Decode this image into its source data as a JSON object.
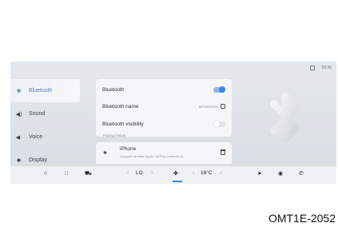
{
  "status": {
    "time": "09:36"
  },
  "sidebar": {
    "items": [
      {
        "label": "Bluetooth",
        "icon": "bluetooth-icon",
        "glyph": "✱",
        "active": true
      },
      {
        "label": "Sound",
        "icon": "speaker-icon",
        "glyph": "◀)",
        "active": false
      },
      {
        "label": "Voice",
        "icon": "voice-icon",
        "glyph": "◀·",
        "active": false
      },
      {
        "label": "Display",
        "icon": "brightness-icon",
        "glyph": "✹",
        "active": false
      }
    ]
  },
  "settings": {
    "bluetooth_label": "Bluetooth",
    "bluetooth_on": true,
    "name_label": "Bluetooth name",
    "name_value": "BTXXXXXX",
    "visibility_label": "Bluetooth visibility",
    "visibility_on": false
  },
  "pairing": {
    "section_label": "Pairing history",
    "device_name": "iPhone",
    "device_sub": "(Support wireless Apple CarPlay connection)"
  },
  "dock": {
    "home": "⌂",
    "apps": "∷",
    "car": "⛟",
    "fan_left": "‹",
    "fan_level": "LO",
    "fan_right": "›",
    "fan_icon": "✤",
    "temp_left": "‹",
    "temp_value": "16°C",
    "temp_right": "›",
    "nav": "➤",
    "media": "◉",
    "phone": "✆"
  },
  "caption": "OMT1E-2052",
  "colors": {
    "accent": "#3e86e6",
    "active_text": "#5a84b3"
  }
}
